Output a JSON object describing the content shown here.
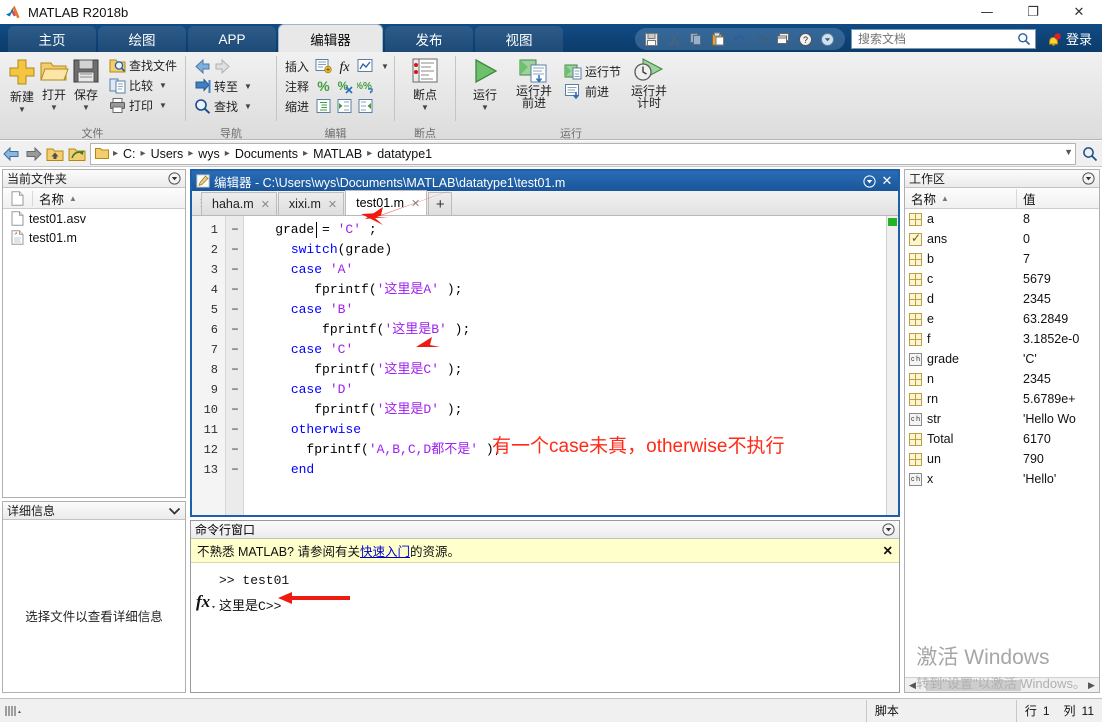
{
  "window": {
    "title": "MATLAB R2018b",
    "app_icon": "matlab-logo-icon",
    "minimize": "—",
    "maximize": "❐",
    "close": "✕"
  },
  "ribbon_tabs": [
    {
      "label": "主页",
      "active": false
    },
    {
      "label": "绘图",
      "active": false
    },
    {
      "label": "APP",
      "active": false
    },
    {
      "label": "编辑器",
      "active": true
    },
    {
      "label": "发布",
      "active": false
    },
    {
      "label": "视图",
      "active": false
    }
  ],
  "quick_access": {
    "icons": [
      "save-icon",
      "cut-icon",
      "copy-icon",
      "paste-icon",
      "undo-icon",
      "redo-icon",
      "windows-layout-icon",
      "help-icon",
      "more-icon"
    ]
  },
  "search": {
    "placeholder": "搜索文档",
    "value": "",
    "icon": "search-icon"
  },
  "notifications": {
    "icon": "bell-icon"
  },
  "sign_in": {
    "label": "登录"
  },
  "ribbon_groups": [
    {
      "label": "文件",
      "big_buttons": [
        {
          "label": "新建",
          "icon": "new-plus-icon",
          "has_caret": true
        },
        {
          "label": "打开",
          "icon": "folder-open-icon",
          "has_caret": true
        },
        {
          "label": "保存",
          "icon": "save-floppy-icon",
          "has_caret": true
        }
      ],
      "small_buttons": [
        {
          "label": "查找文件",
          "icon": "find-files-icon",
          "has_caret": false
        },
        {
          "label": "比较",
          "icon": "compare-icon",
          "has_caret": true
        },
        {
          "label": "打印",
          "icon": "print-icon",
          "has_caret": true
        }
      ]
    },
    {
      "label": "导航",
      "small_buttons": [
        {
          "label": "",
          "icon": "back-forward-arrows-icon",
          "has_caret": false
        },
        {
          "label": "转至",
          "icon": "goto-icon",
          "has_caret": true
        },
        {
          "label": "查找",
          "icon": "find-magnifier-icon",
          "has_caret": true
        }
      ]
    },
    {
      "label": "编辑",
      "rows": [
        {
          "label": "插入",
          "icons": [
            "insert-section-icon",
            "insert-function-icon",
            "insert-figure-icon"
          ],
          "has_caret": true
        },
        {
          "label": "注释",
          "icons": [
            "comment-percent-icon",
            "uncomment-percent-icon",
            "wrap-comment-icon"
          ],
          "has_caret": false
        },
        {
          "label": "缩进",
          "icons": [
            "smart-indent-icon",
            "indent-right-icon",
            "indent-left-icon"
          ],
          "has_caret": false
        }
      ]
    },
    {
      "label": "断点",
      "big_buttons": [
        {
          "label": "断点",
          "icon": "breakpoint-icon",
          "has_caret": true
        }
      ]
    },
    {
      "label": "运行",
      "big_buttons": [
        {
          "label": "运行",
          "icon": "run-play-icon",
          "has_caret": true
        },
        {
          "label": "运行并\n前进",
          "icon": "run-advance-icon",
          "has_caret": false
        },
        {
          "label": "运行并\n计时",
          "icon": "run-and-time-icon",
          "has_caret": false
        }
      ],
      "small_buttons": [
        {
          "label": "运行节",
          "icon": "run-section-icon",
          "has_caret": false
        },
        {
          "label": "前进",
          "icon": "advance-icon",
          "has_caret": false
        }
      ]
    }
  ],
  "pathbar": {
    "back_icon": "back-arrow-icon",
    "forward_icon": "forward-arrow-icon",
    "up_icon": "up-folder-icon",
    "browse_icon": "browse-folder-icon",
    "folder_icon": "folder-icon",
    "crumbs": [
      "C:",
      "Users",
      "wys",
      "Documents",
      "MATLAB",
      "datatype1"
    ],
    "separator": "▸",
    "dropdown_icon": "chevron-down-icon",
    "search_icon": "search-icon"
  },
  "current_folder": {
    "title": "当前文件夹",
    "collapse_icon": "panel-menu-icon",
    "column_header_name": "名称",
    "sort_indicator": "▲",
    "files": [
      {
        "name": "test01.asv",
        "icon": "blank-file-icon"
      },
      {
        "name": "test01.m",
        "icon": "matlab-file-icon"
      }
    ]
  },
  "details": {
    "title": "详细信息",
    "collapse_icon": "chevron-down-icon",
    "empty_text": "选择文件以查看详细信息"
  },
  "editor": {
    "panel_icon": "editor-icon",
    "title": "编辑器 - C:\\Users\\wys\\Documents\\MATLAB\\datatype1\\test01.m",
    "menu_icon": "panel-menu-icon",
    "close_icon": "close-icon",
    "tabs": [
      {
        "label": "haha.m",
        "active": false,
        "close": "✕"
      },
      {
        "label": "xixi.m",
        "active": false,
        "close": "✕"
      },
      {
        "label": "test01.m",
        "active": true,
        "close": "✕"
      }
    ],
    "add_tab_label": "+",
    "code_lines": [
      {
        "num": "1",
        "dash": "−",
        "tokens": [
          {
            "t": "    grade = ",
            "c": "pun"
          },
          {
            "t": "'C'",
            "c": "str"
          },
          {
            "t": " ;",
            "c": "pun"
          }
        ]
      },
      {
        "num": "2",
        "dash": "−",
        "tokens": [
          {
            "t": "      ",
            "c": "pun"
          },
          {
            "t": "switch",
            "c": "kw"
          },
          {
            "t": "(grade)",
            "c": "pun"
          }
        ]
      },
      {
        "num": "3",
        "dash": "−",
        "tokens": [
          {
            "t": "      ",
            "c": "pun"
          },
          {
            "t": "case",
            "c": "kw"
          },
          {
            "t": " ",
            "c": "pun"
          },
          {
            "t": "'A'",
            "c": "str"
          }
        ]
      },
      {
        "num": "4",
        "dash": "−",
        "tokens": [
          {
            "t": "         fprintf(",
            "c": "pun"
          },
          {
            "t": "'这里是A'",
            "c": "str"
          },
          {
            "t": " );",
            "c": "pun"
          }
        ]
      },
      {
        "num": "5",
        "dash": "−",
        "tokens": [
          {
            "t": "      ",
            "c": "pun"
          },
          {
            "t": "case",
            "c": "kw"
          },
          {
            "t": " ",
            "c": "pun"
          },
          {
            "t": "'B'",
            "c": "str"
          }
        ]
      },
      {
        "num": "6",
        "dash": "−",
        "tokens": [
          {
            "t": "          fprintf(",
            "c": "pun"
          },
          {
            "t": "'这里是B'",
            "c": "str"
          },
          {
            "t": " );",
            "c": "pun"
          }
        ]
      },
      {
        "num": "7",
        "dash": "−",
        "tokens": [
          {
            "t": "      ",
            "c": "pun"
          },
          {
            "t": "case",
            "c": "kw"
          },
          {
            "t": " ",
            "c": "pun"
          },
          {
            "t": "'C'",
            "c": "str"
          }
        ]
      },
      {
        "num": "8",
        "dash": "−",
        "tokens": [
          {
            "t": "         fprintf(",
            "c": "pun"
          },
          {
            "t": "'这里是C'",
            "c": "str"
          },
          {
            "t": " );",
            "c": "pun"
          }
        ]
      },
      {
        "num": "9",
        "dash": "−",
        "tokens": [
          {
            "t": "      ",
            "c": "pun"
          },
          {
            "t": "case",
            "c": "kw"
          },
          {
            "t": " ",
            "c": "pun"
          },
          {
            "t": "'D'",
            "c": "str"
          }
        ]
      },
      {
        "num": "10",
        "dash": "−",
        "tokens": [
          {
            "t": "         fprintf(",
            "c": "pun"
          },
          {
            "t": "'这里是D'",
            "c": "str"
          },
          {
            "t": " );",
            "c": "pun"
          }
        ]
      },
      {
        "num": "11",
        "dash": "−",
        "tokens": [
          {
            "t": "      ",
            "c": "pun"
          },
          {
            "t": "otherwise",
            "c": "kw"
          }
        ]
      },
      {
        "num": "12",
        "dash": "−",
        "tokens": [
          {
            "t": "        fprintf(",
            "c": "pun"
          },
          {
            "t": "'A,B,C,D都不是'",
            "c": "str"
          },
          {
            "t": " );",
            "c": "pun"
          }
        ]
      },
      {
        "num": "13",
        "dash": "−",
        "tokens": [
          {
            "t": "      ",
            "c": "pun"
          },
          {
            "t": "end",
            "c": "kw"
          }
        ]
      }
    ],
    "annotation": "有一个case未真，otherwise不执行",
    "annotation_color": "#ff2a18",
    "scroll_marker_color": "#24b324"
  },
  "command_window": {
    "title": "命令行窗口",
    "menu_icon": "panel-menu-icon",
    "banner_prefix": "不熟悉 MATLAB? 请参阅有关",
    "banner_link": "快速入门",
    "banner_suffix": "的资源。",
    "banner_close": "✕",
    "fx_icon": "fx-icon",
    "lines": [
      ">> test01",
      "这里是C>>"
    ]
  },
  "workspace": {
    "title": "工作区",
    "menu_icon": "panel-menu-icon",
    "columns": [
      "名称",
      "值"
    ],
    "sort_indicator": "▲",
    "rows": [
      {
        "icon": "matrix-icon",
        "name": "a",
        "value": "8"
      },
      {
        "icon": "check-matrix-icon",
        "name": "ans",
        "value": "0"
      },
      {
        "icon": "matrix-icon",
        "name": "b",
        "value": "7"
      },
      {
        "icon": "matrix-icon",
        "name": "c",
        "value": "5679"
      },
      {
        "icon": "matrix-icon",
        "name": "d",
        "value": "2345"
      },
      {
        "icon": "matrix-icon",
        "name": "e",
        "value": "63.2849"
      },
      {
        "icon": "matrix-icon",
        "name": "f",
        "value": "3.1852e-0"
      },
      {
        "icon": "char-icon",
        "name": "grade",
        "value": "'C'"
      },
      {
        "icon": "matrix-icon",
        "name": "n",
        "value": "2345"
      },
      {
        "icon": "matrix-icon",
        "name": "rn",
        "value": "5.6789e+"
      },
      {
        "icon": "char-icon",
        "name": "str",
        "value": "'Hello Wo"
      },
      {
        "icon": "matrix-icon",
        "name": "Total",
        "value": "6170"
      },
      {
        "icon": "matrix-icon",
        "name": "un",
        "value": "790"
      },
      {
        "icon": "char-icon",
        "name": "x",
        "value": "'Hello'"
      }
    ],
    "hscroll_left": "◀",
    "hscroll_right": "▶"
  },
  "statusbar": {
    "grip_icon": "resize-grip-icon",
    "file_type": "脚本",
    "row_label": "行",
    "row_value": "1",
    "col_label": "列",
    "col_value": "11"
  },
  "watermark": {
    "line1": "激活 Windows",
    "line2": "转到\"设置\"以激活 Windows。"
  }
}
